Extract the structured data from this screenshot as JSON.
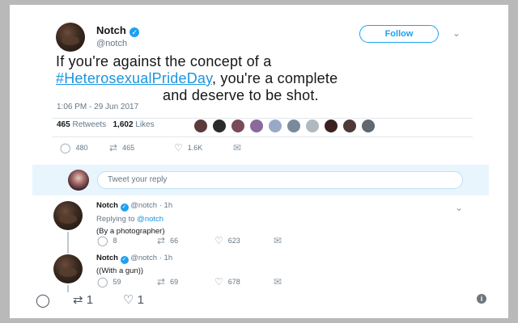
{
  "tweet": {
    "name": "Notch",
    "handle": "@notch",
    "follow_label": "Follow",
    "text_line1": "If you're against the concept of a",
    "hashtag": "#HeterosexualPrideDay",
    "text_line2_rest": ", you're a complete",
    "text_line3_rest": "and deserve to be shot.",
    "timestamp": "1:06 PM - 29 Jun 2017",
    "retweets_count": "465",
    "retweets_label": "Retweets",
    "likes_count": "1,602",
    "likes_label": "Likes",
    "actions": {
      "replies": "480",
      "retweets": "465",
      "likes": "1.6K"
    }
  },
  "reply_box": {
    "placeholder": "Tweet your reply"
  },
  "replies": [
    {
      "name": "Notch",
      "handle": "@notch",
      "time": "· 1h",
      "replying_prefix": "Replying to",
      "replying_to": "@notch",
      "text": "(By a photographer)",
      "actions": {
        "replies": "8",
        "retweets": "66",
        "likes": "623"
      }
    },
    {
      "name": "Notch",
      "handle": "@notch",
      "time": "· 1h",
      "text": "((With a gun))",
      "actions": {
        "replies": "59",
        "retweets": "69",
        "likes": "678"
      }
    }
  ],
  "bottom_actions": {
    "retweets": "1",
    "likes": "1"
  },
  "liker_colors": [
    "#5a3a3a",
    "#2b2b2b",
    "#7a4a5a",
    "#8a6a9a",
    "#9aa8c8",
    "#7a8a9a",
    "#b0b8c0",
    "#3a2020",
    "#503838",
    "#606870"
  ],
  "colors": {
    "accent": "#1da1f2",
    "link": "#1b95e0",
    "muted": "#657786"
  },
  "icons": [
    "verified-icon",
    "chevron-down-icon",
    "reply-icon",
    "retweet-icon",
    "like-icon",
    "message-icon",
    "info-icon"
  ]
}
